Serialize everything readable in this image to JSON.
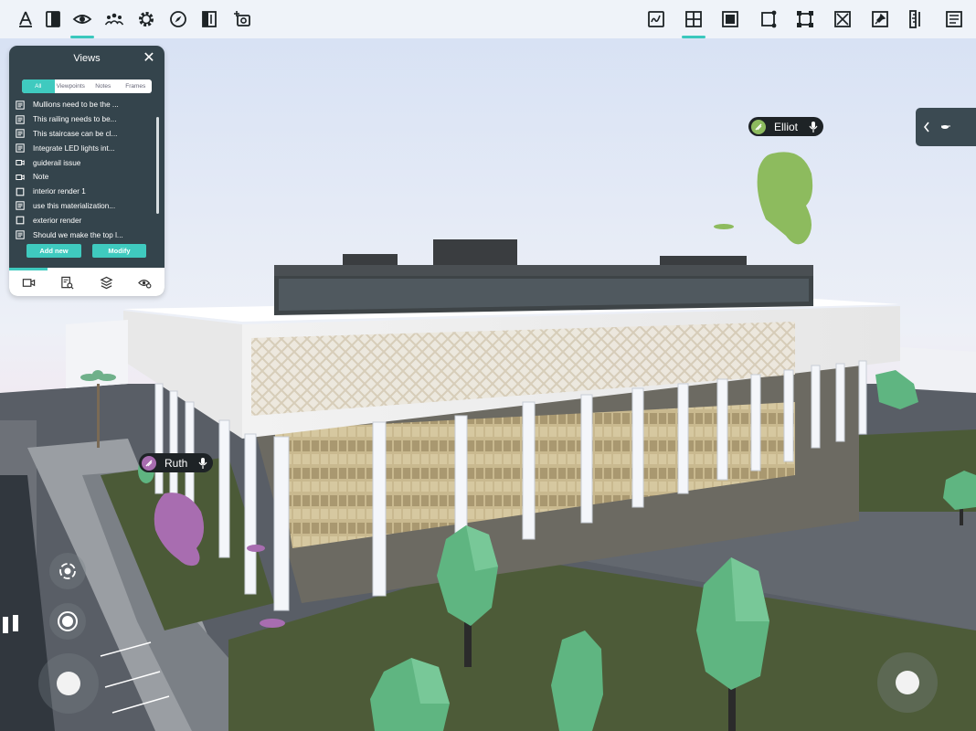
{
  "toolbar": {
    "left_icons": [
      "measure-icon",
      "panel-icon",
      "eye-icon",
      "people-icon",
      "gear-icon",
      "compass-icon",
      "section-icon",
      "add-view-icon"
    ],
    "right_icons": [
      "sketch-icon",
      "plane-icon",
      "solid-icon",
      "edit-shape-icon",
      "transform-icon",
      "box-x-icon",
      "pin-icon",
      "ruler-icon",
      "notes-icon"
    ],
    "active_left": "eye-icon",
    "active_right": "plane-icon"
  },
  "views_panel": {
    "title": "Views",
    "close_glyph": "✕",
    "tabs": [
      {
        "label": "All",
        "selected": true
      },
      {
        "label": "Viewpoints",
        "selected": false
      },
      {
        "label": "Notes",
        "selected": false
      },
      {
        "label": "Frames",
        "selected": false
      }
    ],
    "items": [
      {
        "icon": "note-icon",
        "label": "Mullions need to be the ..."
      },
      {
        "icon": "note-icon",
        "label": "This railing needs to be..."
      },
      {
        "icon": "note-icon",
        "label": "This staircase can be cl..."
      },
      {
        "icon": "note-icon",
        "label": "Integrate LED lights int..."
      },
      {
        "icon": "camera-icon",
        "label": "guiderail issue"
      },
      {
        "icon": "camera-icon",
        "label": "Note"
      },
      {
        "icon": "frame-icon",
        "label": "interior render 1"
      },
      {
        "icon": "note-icon",
        "label": "use this materialization..."
      },
      {
        "icon": "frame-icon",
        "label": "exterior render"
      },
      {
        "icon": "note-icon",
        "label": "Should we make the top l..."
      }
    ],
    "add_label": "Add new",
    "modify_label": "Modify",
    "bottom_icons": [
      "camera-icon",
      "search-doc-icon",
      "layers-icon",
      "eye-settings-icon"
    ]
  },
  "users": [
    {
      "name": "Elliot",
      "color": "#8dbb5e"
    },
    {
      "name": "Ruth",
      "color": "#a86db0"
    }
  ],
  "right_panel": {
    "icon": "chevron-left-icon"
  },
  "colors": {
    "accent": "#3fcabf",
    "panel": "#34444c",
    "sky": "#dfe7f4",
    "grass": "#4f5b3d"
  }
}
